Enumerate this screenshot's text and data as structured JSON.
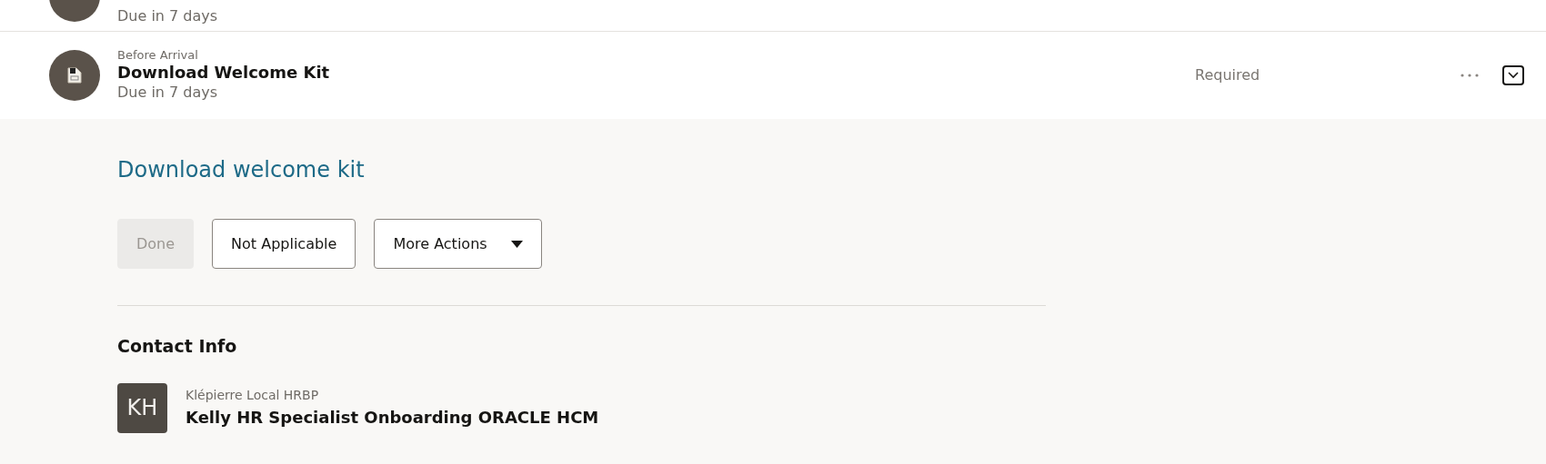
{
  "tasks": [
    {
      "due": "Due in 7 days"
    },
    {
      "category": "Before Arrival",
      "title": "Download Welcome Kit",
      "due": "Due in 7 days",
      "status": "Required",
      "expanded": true,
      "detail": {
        "link": "Download welcome kit",
        "buttons": [
          {
            "label": "Done",
            "disabled": true,
            "kind": "plain"
          },
          {
            "label": "Not Applicable",
            "disabled": false,
            "kind": "plain"
          },
          {
            "label": "More Actions",
            "disabled": false,
            "kind": "menu"
          }
        ],
        "contact_heading": "Contact Info",
        "contact": {
          "initials": "KH",
          "role": "Klépierre Local HRBP",
          "name": "Kelly HR Specialist Onboarding ORACLE HCM"
        }
      }
    }
  ]
}
